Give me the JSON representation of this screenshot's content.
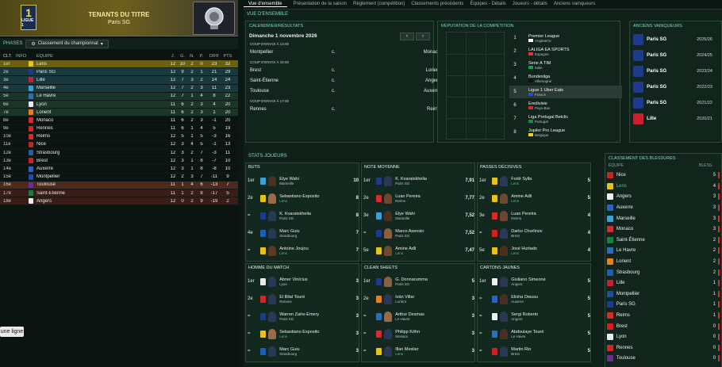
{
  "header": {
    "title": "TENANTS DU TITRE",
    "subtitle": "Paris SG",
    "logo_num": "1",
    "logo_text": "LIGUE 1"
  },
  "phases": {
    "label": "PHASES",
    "dropdown": "Classement du championnat"
  },
  "table": {
    "cols": [
      "CLT.",
      "INFO",
      "ÉQUIPE",
      "J.",
      "G.",
      "N.",
      "P.",
      "DIFF",
      "PTS"
    ],
    "rows": [
      {
        "pos": "1er",
        "team": "Lens",
        "j": "12",
        "g": "10",
        "n": "2",
        "p": "0",
        "diff": "23",
        "pts": "32",
        "zone": "champ",
        "col": "#e8c21b"
      },
      {
        "pos": "2e",
        "team": "Paris SG",
        "j": "12",
        "g": "9",
        "n": "2",
        "p": "1",
        "diff": "21",
        "pts": "29",
        "zone": "cl",
        "col": "#1d3b8a"
      },
      {
        "pos": "3e",
        "team": "Lille",
        "j": "12",
        "g": "7",
        "n": "3",
        "p": "2",
        "diff": "14",
        "pts": "24",
        "zone": "cl",
        "col": "#c8202f"
      },
      {
        "pos": "4e",
        "team": "Marseille",
        "j": "12",
        "g": "7",
        "n": "2",
        "p": "3",
        "diff": "11",
        "pts": "23",
        "zone": "cl",
        "col": "#3aa0d8"
      },
      {
        "pos": "5e",
        "team": "Le Havre",
        "j": "12",
        "g": "7",
        "n": "1",
        "p": "4",
        "diff": "8",
        "pts": "22",
        "zone": "el",
        "col": "#2d6fb5"
      },
      {
        "pos": "6e",
        "team": "Lyon",
        "j": "11",
        "g": "6",
        "n": "2",
        "p": "3",
        "diff": "4",
        "pts": "20",
        "zone": "el",
        "col": "#e9e9ef"
      },
      {
        "pos": "7e",
        "team": "Lorient",
        "j": "11",
        "g": "6",
        "n": "2",
        "p": "3",
        "diff": "1",
        "pts": "20",
        "zone": "el",
        "col": "#f07d1c"
      },
      {
        "pos": "8e",
        "team": "Monaco",
        "j": "11",
        "g": "6",
        "n": "2",
        "p": "3",
        "diff": "-1",
        "pts": "20",
        "zone": "",
        "col": "#d92a2a"
      },
      {
        "pos": "9e",
        "team": "Rennes",
        "j": "11",
        "g": "6",
        "n": "1",
        "p": "4",
        "diff": "5",
        "pts": "19",
        "zone": "",
        "col": "#d02626"
      },
      {
        "pos": "10e",
        "team": "Reims",
        "j": "12",
        "g": "5",
        "n": "1",
        "p": "5",
        "diff": "-3",
        "pts": "16",
        "zone": "",
        "col": "#d52b2b"
      },
      {
        "pos": "11e",
        "team": "Nice",
        "j": "12",
        "g": "3",
        "n": "4",
        "p": "5",
        "diff": "-1",
        "pts": "13",
        "zone": "",
        "col": "#c52424"
      },
      {
        "pos": "12e",
        "team": "Strasbourg",
        "j": "12",
        "g": "3",
        "n": "2",
        "p": "7",
        "diff": "-3",
        "pts": "11",
        "zone": "",
        "col": "#1f5fb0"
      },
      {
        "pos": "13e",
        "team": "Brest",
        "j": "12",
        "g": "3",
        "n": "1",
        "p": "8",
        "diff": "-7",
        "pts": "10",
        "zone": "",
        "col": "#d21f1f"
      },
      {
        "pos": "14e",
        "team": "Auxerre",
        "j": "12",
        "g": "3",
        "n": "1",
        "p": "8",
        "diff": "-8",
        "pts": "10",
        "zone": "",
        "col": "#2a63c2"
      },
      {
        "pos": "15e",
        "team": "Montpellier",
        "j": "12",
        "g": "2",
        "n": "3",
        "p": "7",
        "diff": "-11",
        "pts": "9",
        "zone": "",
        "col": "#1e4e9a"
      },
      {
        "pos": "16e",
        "team": "Toulouse",
        "j": "11",
        "g": "1",
        "n": "4",
        "p": "6",
        "diff": "-13",
        "pts": "7",
        "zone": "pl",
        "col": "#6b2f94"
      },
      {
        "pos": "17e",
        "team": "Saint-Étienne",
        "j": "11",
        "g": "1",
        "n": "2",
        "p": "8",
        "diff": "-17",
        "pts": "5",
        "zone": "rel",
        "col": "#18803c"
      },
      {
        "pos": "18e",
        "team": "Angers",
        "j": "12",
        "g": "0",
        "n": "2",
        "p": "9",
        "diff": "-19",
        "pts": "2",
        "zone": "rel",
        "col": "#eeeeee"
      }
    ]
  },
  "button": {
    "label": "une ligne"
  },
  "nav": [
    "Vue d'ensemble",
    "Présentation de la saison",
    "Règlement (compétition)",
    "Classements précédents",
    "Équipes - Détails",
    "Joueurs - détails",
    "Anciens vainqueurs"
  ],
  "overview": {
    "title": "VUE D'ENSEMBLE"
  },
  "calendar": {
    "title": "CALENDRIER/RÉSULTATS",
    "date": "Dimanche 1 novembre 2026",
    "prev": "‹",
    "next": "›",
    "groups": [
      {
        "kickoff": "COUP D'ENVOI À 13:00",
        "matches": [
          {
            "home": "Montpellier",
            "mid": "c.",
            "away": "Monaco"
          }
        ]
      },
      {
        "kickoff": "COUP D'ENVOI À 15:00",
        "matches": [
          {
            "home": "Brest",
            "mid": "c.",
            "away": "Lorient"
          },
          {
            "home": "Saint-Étienne",
            "mid": "c.",
            "away": "Angers"
          },
          {
            "home": "Toulouse",
            "mid": "c.",
            "away": "Auxerre"
          }
        ]
      },
      {
        "kickoff": "COUP D'ENVOI À 17:00",
        "matches": [
          {
            "home": "Rennes",
            "mid": "c.",
            "away": "Reims"
          }
        ]
      }
    ]
  },
  "reputation": {
    "title": "RÉPUTATION DE LA COMPÉTITION",
    "items": [
      {
        "rank": "1",
        "league": "Premier League",
        "country": "Angleterre",
        "flag": "#ffffff"
      },
      {
        "rank": "2",
        "league": "LALIGA EA SPORTS",
        "country": "Espagne",
        "flag": "#e3342f"
      },
      {
        "rank": "3",
        "league": "Serie A TIM",
        "country": "Italie",
        "flag": "#1c9b48"
      },
      {
        "rank": "4",
        "league": "Bundesliga",
        "country": "Allemagne",
        "flag": "#111111"
      },
      {
        "rank": "5",
        "league": "Ligue 1 Uber Eats",
        "country": "France",
        "flag": "#2a4fbf",
        "selected": true
      },
      {
        "rank": "6",
        "league": "Eredivisie",
        "country": "Pays-Bas",
        "flag": "#d22b2b"
      },
      {
        "rank": "7",
        "league": "Liga Portugal Betclic",
        "country": "Portugal",
        "flag": "#1b8a3d"
      },
      {
        "rank": "8",
        "league": "Jupiler Pro League",
        "country": "Belgique",
        "flag": "#f2d21b"
      }
    ]
  },
  "winners": {
    "title": "ANCIENS VAINQUEURS",
    "items": [
      {
        "team": "Paris SG",
        "years": "2025/26",
        "col": "#1d3b8a"
      },
      {
        "team": "Paris SG",
        "years": "2024/25",
        "col": "#1d3b8a"
      },
      {
        "team": "Paris SG",
        "years": "2023/24",
        "col": "#1d3b8a"
      },
      {
        "team": "Paris SG",
        "years": "2022/23",
        "col": "#1d3b8a"
      },
      {
        "team": "Paris SG",
        "years": "2021/22",
        "col": "#1d3b8a"
      },
      {
        "team": "Lille",
        "years": "2020/21",
        "col": "#c8202f"
      }
    ]
  },
  "stats": {
    "title": "STATS JOUEURS",
    "boxes": [
      {
        "title": "BUTS",
        "rows": [
          {
            "rank": "1er",
            "name": "Elye Wahi",
            "team": "Marseille",
            "val": "10",
            "col": "#3aa0d8",
            "skin": "#4a3020"
          },
          {
            "rank": "2e",
            "name": "Sebastiano Esposito",
            "team": "Lens",
            "val": "8",
            "col": "#e8c21b",
            "skin": "#9a6b4a",
            "green": true
          },
          {
            "rank": "=",
            "name": "K. Kvaratskhelia",
            "team": "Paris SG",
            "val": "8",
            "col": "#1d3b8a",
            "skin": "#2a3855"
          },
          {
            "rank": "4e",
            "name": "Marc Guiu",
            "team": "Strasbourg",
            "val": "7",
            "col": "#1f5fb0",
            "skin": "#2a3855"
          },
          {
            "rank": "=",
            "name": "Antoine Joujou",
            "team": "Lens",
            "val": "7",
            "col": "#e8c21b",
            "skin": "#5a3a26",
            "green": true
          }
        ]
      },
      {
        "title": "NOTE MOYENNE",
        "rows": [
          {
            "rank": "1er",
            "name": "K. Kvaratskhelia",
            "team": "Paris SG",
            "val": "7,91",
            "col": "#1d3b8a",
            "skin": "#2a3855"
          },
          {
            "rank": "2e",
            "name": "Luan Pereira",
            "team": "Reims",
            "val": "7,77",
            "col": "#d52b2b",
            "skin": "#6b4630"
          },
          {
            "rank": "3e",
            "name": "Elye Wahi",
            "team": "Marseille",
            "val": "7,52",
            "col": "#3aa0d8",
            "skin": "#4a3020"
          },
          {
            "rank": "=",
            "name": "Marco Asensio",
            "team": "Paris SG",
            "val": "7,52",
            "col": "#1d3b8a",
            "skin": "#8a6040"
          },
          {
            "rank": "5e",
            "name": "Amine Adli",
            "team": "Lens",
            "val": "7,47",
            "col": "#e8c21b",
            "skin": "#6b4a30",
            "green": true
          }
        ]
      },
      {
        "title": "PASSES DÉCISIVES",
        "rows": [
          {
            "rank": "1er",
            "name": "Fodé Sylla",
            "team": "Lens",
            "val": "5",
            "col": "#e8c21b",
            "skin": "#2a3855",
            "green": true
          },
          {
            "rank": "2e",
            "name": "Amine Adli",
            "team": "Lens",
            "val": "5",
            "col": "#e8c21b",
            "skin": "#6b4a30",
            "green": true
          },
          {
            "rank": "3e",
            "name": "Luan Pereira",
            "team": "Reims",
            "val": "4",
            "col": "#d52b2b",
            "skin": "#6b4630"
          },
          {
            "rank": "=",
            "name": "Darko Churlinov",
            "team": "Brest",
            "val": "4",
            "col": "#d21f1f",
            "skin": "#2a3855"
          },
          {
            "rank": "5e",
            "name": "José Hurtado",
            "team": "Lens",
            "val": "4",
            "col": "#e8c21b",
            "skin": "#4a3020",
            "green": true
          }
        ]
      },
      {
        "title": "HOMME DU MATCH",
        "rows": [
          {
            "rank": "1er",
            "name": "Abner Vinícius",
            "team": "Lyon",
            "val": "3",
            "col": "#e9e9ef",
            "skin": "#2a3855"
          },
          {
            "rank": "2e",
            "name": "El Bilal Touré",
            "team": "Rennes",
            "val": "3",
            "col": "#d02626",
            "skin": "#2a3855"
          },
          {
            "rank": "=",
            "name": "Warren Zaïre-Emery",
            "team": "Paris SG",
            "val": "3",
            "col": "#1d3b8a",
            "skin": "#2a3855"
          },
          {
            "rank": "=",
            "name": "Sebastiano Esposito",
            "team": "Lens",
            "val": "3",
            "col": "#e8c21b",
            "skin": "#9a6b4a",
            "green": true
          },
          {
            "rank": "=",
            "name": "Marc Guiu",
            "team": "Strasbourg",
            "val": "3",
            "col": "#1f5fb0",
            "skin": "#2a3855"
          }
        ]
      },
      {
        "title": "CLEAN SHEETS",
        "rows": [
          {
            "rank": "1er",
            "name": "G. Donnarumma",
            "team": "Paris SG",
            "val": "5",
            "col": "#1d3b8a",
            "skin": "#8a6040"
          },
          {
            "rank": "2e",
            "name": "Iván Villar",
            "team": "Lorient",
            "val": "3",
            "col": "#f07d1c",
            "skin": "#2a3855"
          },
          {
            "rank": "=",
            "name": "Arthur Desmas",
            "team": "Le Havre",
            "val": "3",
            "col": "#2d6fb5",
            "skin": "#9a6b4a"
          },
          {
            "rank": "=",
            "name": "Philipp Köhn",
            "team": "Monaco",
            "val": "3",
            "col": "#d92a2a",
            "skin": "#2a3855"
          },
          {
            "rank": "=",
            "name": "Illan Meslier",
            "team": "Lens",
            "val": "3",
            "col": "#e8c21b",
            "skin": "#2a3855",
            "green": true
          }
        ]
      },
      {
        "title": "CARTONS JAUNES",
        "rows": [
          {
            "rank": "1er",
            "name": "Giuliano Simeone",
            "team": "Angers",
            "val": "5",
            "col": "#eeeeee",
            "skin": "#2a3855"
          },
          {
            "rank": "=",
            "name": "Elisha Owusu",
            "team": "Auxerre",
            "val": "5",
            "col": "#2a63c2",
            "skin": "#4a3020"
          },
          {
            "rank": "=",
            "name": "Sergi Roberto",
            "team": "Angers",
            "val": "5",
            "col": "#eeeeee",
            "skin": "#2a3855"
          },
          {
            "rank": "=",
            "name": "Abdoulaye Touré",
            "team": "Le Havre",
            "val": "5",
            "col": "#2d6fb5",
            "skin": "#4a3020"
          },
          {
            "rank": "=",
            "name": "Martin Rio",
            "team": "Brest",
            "val": "5",
            "col": "#d21f1f",
            "skin": "#2a3855"
          }
        ]
      }
    ]
  },
  "injuries": {
    "title": "CLASSEMENT DES BLESSURES",
    "col_team": "ÉQUIPE",
    "col_val": "BLESS.",
    "rows": [
      {
        "team": "Nice",
        "val": "5",
        "col": "#c52424"
      },
      {
        "team": "Lens",
        "val": "4",
        "col": "#e8c21b",
        "green": true
      },
      {
        "team": "Angers",
        "val": "3",
        "col": "#eeeeee"
      },
      {
        "team": "Auxerre",
        "val": "3",
        "col": "#2a63c2"
      },
      {
        "team": "Marseille",
        "val": "3",
        "col": "#3aa0d8"
      },
      {
        "team": "Monaco",
        "val": "3",
        "col": "#d92a2a"
      },
      {
        "team": "Saint-Étienne",
        "val": "2",
        "col": "#18803c"
      },
      {
        "team": "Le Havre",
        "val": "2",
        "col": "#2d6fb5"
      },
      {
        "team": "Lorient",
        "val": "2",
        "col": "#f07d1c"
      },
      {
        "team": "Strasbourg",
        "val": "2",
        "col": "#1f5fb0"
      },
      {
        "team": "Lille",
        "val": "1",
        "col": "#c8202f"
      },
      {
        "team": "Montpellier",
        "val": "1",
        "col": "#1e4e9a"
      },
      {
        "team": "Paris SG",
        "val": "1",
        "col": "#1d3b8a"
      },
      {
        "team": "Reims",
        "val": "1",
        "col": "#d52b2b"
      },
      {
        "team": "Brest",
        "val": "0",
        "col": "#d21f1f"
      },
      {
        "team": "Lyon",
        "val": "0",
        "col": "#e9e9ef"
      },
      {
        "team": "Rennes",
        "val": "0",
        "col": "#d02626"
      },
      {
        "team": "Toulouse",
        "val": "0",
        "col": "#6b2f94"
      }
    ]
  }
}
